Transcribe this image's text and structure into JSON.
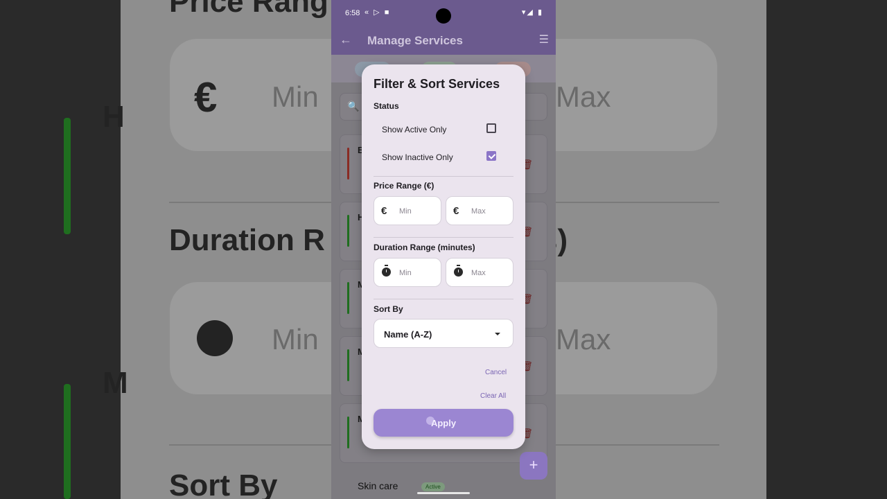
{
  "background": {
    "price_heading": "Price Rang",
    "euro_symbol": "€",
    "min_hint": "Min",
    "max_hint": "Max",
    "h_letter": "H",
    "duration_heading": "Duration R",
    "duration_tail": "s)",
    "m_letter": "M",
    "sort_heading": "Sort By"
  },
  "statusbar": {
    "time": "6:58",
    "left_icons": "« ▷ ■",
    "right_icons": "▾◢ ▮"
  },
  "appbar": {
    "back_icon": "←",
    "title": "Manage Services",
    "sort_icon": "☰"
  },
  "list": {
    "search_icon": "🔍",
    "delete_icon": "🗑",
    "items": [
      {
        "initial": "B",
        "bar_color": "#8a2b24"
      },
      {
        "initial": "H",
        "bar_color": "#1f6e1f"
      },
      {
        "initial": "M",
        "bar_color": "#1f6e1f"
      },
      {
        "initial": "M",
        "bar_color": "#1f6e1f"
      },
      {
        "initial": "M",
        "bar_color": "#1f6e1f"
      }
    ],
    "last_item_name": "Skin care",
    "last_item_badge": "Active",
    "fab_icon": "+"
  },
  "dialog": {
    "title": "Filter & Sort Services",
    "status_label": "Status",
    "show_active_label": "Show Active Only",
    "show_active_checked": false,
    "show_inactive_label": "Show Inactive Only",
    "show_inactive_checked": true,
    "price_label": "Price Range (€)",
    "price_icon": "€",
    "min_placeholder": "Min",
    "max_placeholder": "Max",
    "duration_label": "Duration Range (minutes)",
    "sort_label": "Sort By",
    "sort_value": "Name (A-Z)",
    "cancel_label": "Cancel",
    "clear_label": "Clear All",
    "apply_label": "Apply"
  },
  "colors": {
    "accent": "#9b86d2",
    "appbar": "#6b5a8e",
    "dialog_bg": "#ebe4ee"
  }
}
